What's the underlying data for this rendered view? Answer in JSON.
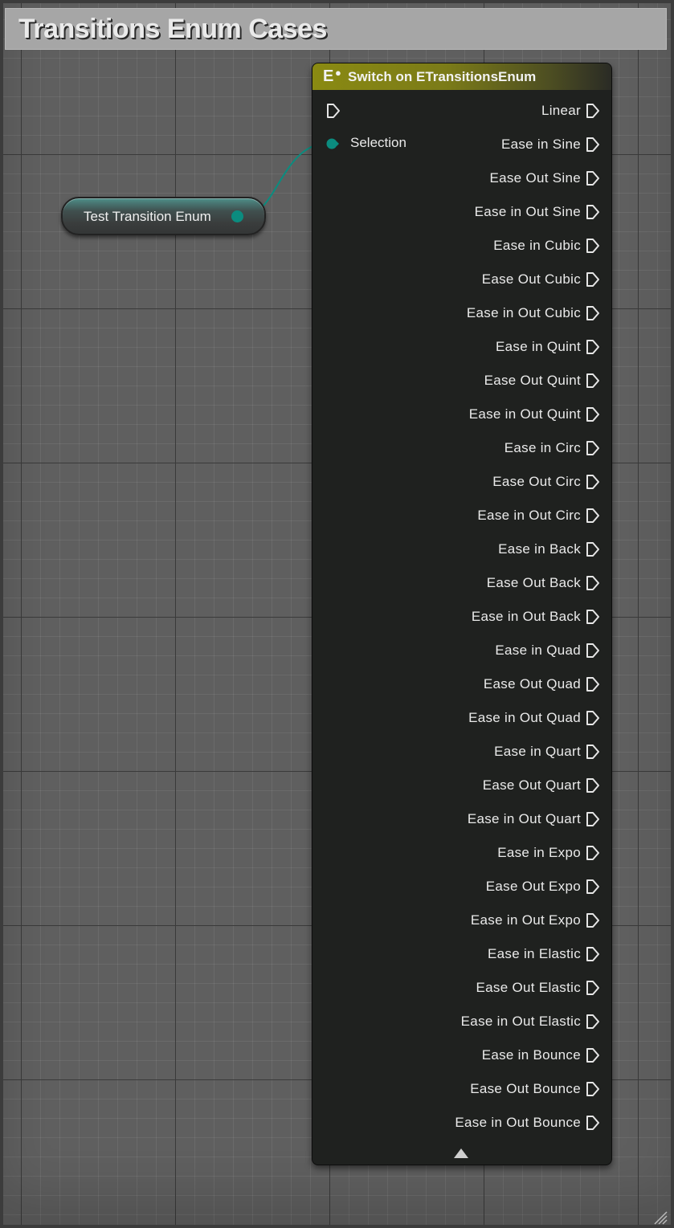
{
  "comment": {
    "title": "Transitions Enum Cases"
  },
  "variable_node": {
    "label": "Test Transition Enum",
    "pin_color": "#0b8c7f"
  },
  "switch_node": {
    "title": "Switch on ETransitionsEnum",
    "header_color": "#8a8a12",
    "icon": "switch-enum-icon",
    "inputs": {
      "exec": "exec-in-pin",
      "selection_label": "Selection"
    },
    "outputs": [
      "Linear",
      "Ease in Sine",
      "Ease Out Sine",
      "Ease in Out Sine",
      "Ease in Cubic",
      "Ease Out Cubic",
      "Ease in Out Cubic",
      "Ease in Quint",
      "Ease Out Quint",
      "Ease in Out Quint",
      "Ease in Circ",
      "Ease Out Circ",
      "Ease in Out Circ",
      "Ease in Back",
      "Ease Out Back",
      "Ease in Out Back",
      "Ease in Quad",
      "Ease Out Quad",
      "Ease in Out Quad",
      "Ease in Quart",
      "Ease Out Quart",
      "Ease in Out Quart",
      "Ease in Expo",
      "Ease Out Expo",
      "Ease in Out Expo",
      "Ease in Elastic",
      "Ease Out Elastic",
      "Ease in Out Elastic",
      "Ease in Bounce",
      "Ease Out Bounce",
      "Ease in Out Bounce"
    ]
  }
}
